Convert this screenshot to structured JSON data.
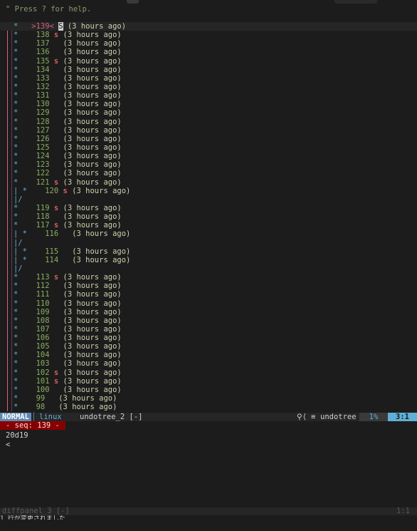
{
  "help_text": "\" Press ? for help.",
  "tree": [
    {
      "prefix": "   ",
      "mark": "*",
      "gap": "   ",
      "num": ">139<",
      "save": "S",
      "ago": "(3 hours ago)",
      "current": true
    },
    {
      "prefix": "   ",
      "mark": "*",
      "gap": "    ",
      "num": "138",
      "save": "s",
      "ago": "(3 hours ago)"
    },
    {
      "prefix": "   ",
      "mark": "*",
      "gap": "    ",
      "num": "137",
      "save": "",
      "ago": "(3 hours ago)"
    },
    {
      "prefix": "   ",
      "mark": "*",
      "gap": "    ",
      "num": "136",
      "save": "",
      "ago": "(3 hours ago)"
    },
    {
      "prefix": "   ",
      "mark": "*",
      "gap": "    ",
      "num": "135",
      "save": "s",
      "ago": "(3 hours ago)"
    },
    {
      "prefix": "   ",
      "mark": "*",
      "gap": "    ",
      "num": "134",
      "save": "",
      "ago": "(3 hours ago)"
    },
    {
      "prefix": "   ",
      "mark": "*",
      "gap": "    ",
      "num": "133",
      "save": "",
      "ago": "(3 hours ago)"
    },
    {
      "prefix": "   ",
      "mark": "*",
      "gap": "    ",
      "num": "132",
      "save": "",
      "ago": "(3 hours ago)"
    },
    {
      "prefix": "   ",
      "mark": "*",
      "gap": "    ",
      "num": "131",
      "save": "",
      "ago": "(3 hours ago)"
    },
    {
      "prefix": "   ",
      "mark": "*",
      "gap": "    ",
      "num": "130",
      "save": "",
      "ago": "(3 hours ago)"
    },
    {
      "prefix": "   ",
      "mark": "*",
      "gap": "    ",
      "num": "129",
      "save": "",
      "ago": "(3 hours ago)"
    },
    {
      "prefix": "   ",
      "mark": "*",
      "gap": "    ",
      "num": "128",
      "save": "",
      "ago": "(3 hours ago)"
    },
    {
      "prefix": "   ",
      "mark": "*",
      "gap": "    ",
      "num": "127",
      "save": "",
      "ago": "(3 hours ago)"
    },
    {
      "prefix": "   ",
      "mark": "*",
      "gap": "    ",
      "num": "126",
      "save": "",
      "ago": "(3 hours ago)"
    },
    {
      "prefix": "   ",
      "mark": "*",
      "gap": "    ",
      "num": "125",
      "save": "",
      "ago": "(3 hours ago)"
    },
    {
      "prefix": "   ",
      "mark": "*",
      "gap": "    ",
      "num": "124",
      "save": "",
      "ago": "(3 hours ago)"
    },
    {
      "prefix": "   ",
      "mark": "*",
      "gap": "    ",
      "num": "123",
      "save": "",
      "ago": "(3 hours ago)"
    },
    {
      "prefix": "   ",
      "mark": "*",
      "gap": "    ",
      "num": "122",
      "save": "",
      "ago": "(3 hours ago)"
    },
    {
      "prefix": "   ",
      "mark": "*",
      "gap": "    ",
      "num": "121",
      "save": "s",
      "ago": "(3 hours ago)"
    },
    {
      "prefix": "   ",
      "mark": "| *",
      "gap": "    ",
      "num": "120",
      "save": "s",
      "ago": "(3 hours ago)"
    },
    {
      "prefix": "   ",
      "mark": "|/",
      "gap": "",
      "num": "",
      "save": "",
      "ago": ""
    },
    {
      "prefix": "   ",
      "mark": "*",
      "gap": "    ",
      "num": "119",
      "save": "s",
      "ago": "(3 hours ago)"
    },
    {
      "prefix": "   ",
      "mark": "*",
      "gap": "    ",
      "num": "118",
      "save": "",
      "ago": "(3 hours ago)"
    },
    {
      "prefix": "   ",
      "mark": "*",
      "gap": "    ",
      "num": "117",
      "save": "s",
      "ago": "(3 hours ago)"
    },
    {
      "prefix": "   ",
      "mark": "| *",
      "gap": "    ",
      "num": "116",
      "save": "",
      "ago": "(3 hours ago)"
    },
    {
      "prefix": "   ",
      "mark": "|/",
      "gap": "",
      "num": "",
      "save": "",
      "ago": ""
    },
    {
      "prefix": "   ",
      "mark": "| *",
      "gap": "    ",
      "num": "115",
      "save": "",
      "ago": "(3 hours ago)"
    },
    {
      "prefix": "   ",
      "mark": "| *",
      "gap": "    ",
      "num": "114",
      "save": "",
      "ago": "(3 hours ago)"
    },
    {
      "prefix": "   ",
      "mark": "|/",
      "gap": "",
      "num": "",
      "save": "",
      "ago": ""
    },
    {
      "prefix": "   ",
      "mark": "*",
      "gap": "    ",
      "num": "113",
      "save": "s",
      "ago": "(3 hours ago)"
    },
    {
      "prefix": "   ",
      "mark": "*",
      "gap": "    ",
      "num": "112",
      "save": "",
      "ago": "(3 hours ago)"
    },
    {
      "prefix": "   ",
      "mark": "*",
      "gap": "    ",
      "num": "111",
      "save": "",
      "ago": "(3 hours ago)"
    },
    {
      "prefix": "   ",
      "mark": "*",
      "gap": "    ",
      "num": "110",
      "save": "",
      "ago": "(3 hours ago)"
    },
    {
      "prefix": "   ",
      "mark": "*",
      "gap": "    ",
      "num": "109",
      "save": "",
      "ago": "(3 hours ago)"
    },
    {
      "prefix": "   ",
      "mark": "*",
      "gap": "    ",
      "num": "108",
      "save": "",
      "ago": "(3 hours ago)"
    },
    {
      "prefix": "   ",
      "mark": "*",
      "gap": "    ",
      "num": "107",
      "save": "",
      "ago": "(3 hours ago)"
    },
    {
      "prefix": "   ",
      "mark": "*",
      "gap": "    ",
      "num": "106",
      "save": "",
      "ago": "(3 hours ago)"
    },
    {
      "prefix": "   ",
      "mark": "*",
      "gap": "    ",
      "num": "105",
      "save": "",
      "ago": "(3 hours ago)"
    },
    {
      "prefix": "   ",
      "mark": "*",
      "gap": "    ",
      "num": "104",
      "save": "",
      "ago": "(3 hours ago)"
    },
    {
      "prefix": "   ",
      "mark": "*",
      "gap": "    ",
      "num": "103",
      "save": "",
      "ago": "(3 hours ago)"
    },
    {
      "prefix": "   ",
      "mark": "*",
      "gap": "    ",
      "num": "102",
      "save": "s",
      "ago": "(3 hours ago)"
    },
    {
      "prefix": "   ",
      "mark": "*",
      "gap": "    ",
      "num": "101",
      "save": "s",
      "ago": "(3 hours ago)"
    },
    {
      "prefix": "   ",
      "mark": "*",
      "gap": "    ",
      "num": "100",
      "save": "",
      "ago": "(3 hours ago)"
    },
    {
      "prefix": "   ",
      "mark": "*",
      "gap": "    ",
      "num": "99",
      "save": "",
      "ago": "(3 hours ago)"
    },
    {
      "prefix": "   ",
      "mark": "*",
      "gap": "    ",
      "num": "98",
      "save": "",
      "ago": "(3 hours ago)"
    }
  ],
  "statusline": {
    "mode": "NORMAL",
    "os_label": "linux",
    "file_name": "undotree_2 [-]",
    "filetype_icon": "undotree-icon",
    "filetype": "undotree",
    "percent": "1%",
    "position": "3:1"
  },
  "diffpanel": {
    "seq_label": "- seq: 139 -",
    "line1": "20d19",
    "line2": "<"
  },
  "statusline2": {
    "file_name": "diffpanel_3 [-]",
    "position": "1:1"
  },
  "cmdline": "1 行が変更されました",
  "colors": {
    "background": "#1c1c1c",
    "mode_bg": "#5f87af",
    "accent": "#5fafd7",
    "seq_bg": "#870000",
    "save_mark": "#d75f5f",
    "node_number": "#87af5f",
    "current_node": "#d75f87"
  }
}
